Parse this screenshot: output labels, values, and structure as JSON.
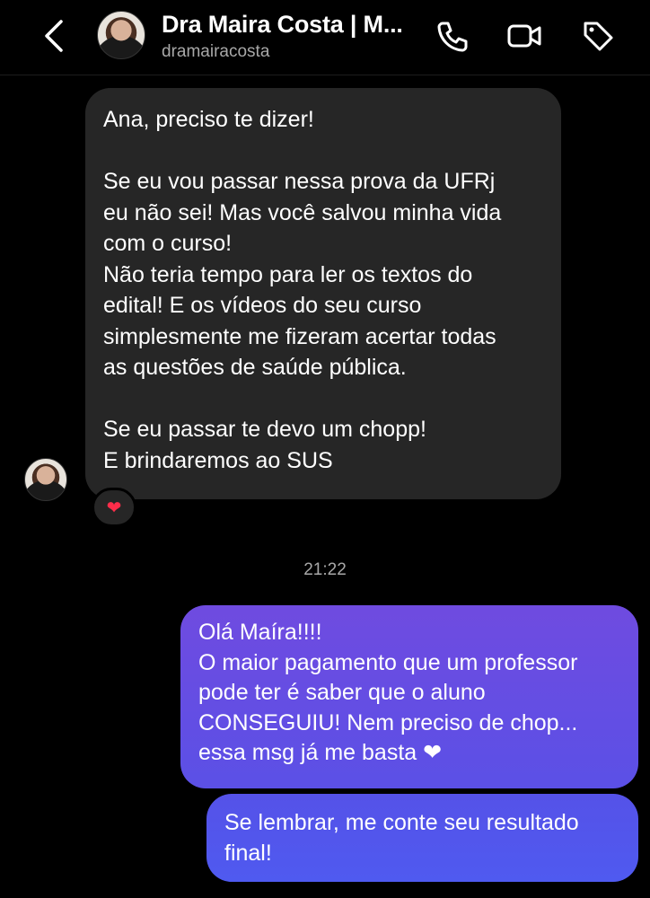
{
  "header": {
    "title": "Dra Maira Costa | M...",
    "username": "dramairacosta",
    "icons": [
      "back-arrow-icon",
      "phone-icon",
      "video-camera-icon",
      "tag-icon"
    ]
  },
  "incoming": {
    "paragraphs": [
      [
        "Ana, preciso te dizer!"
      ],
      [
        "Se eu vou passar nessa prova da UFRj",
        "eu não sei! Mas você salvou minha vida",
        "com o curso!",
        "Não teria tempo para ler os textos do",
        "edital! E os vídeos do seu curso",
        "simplesmente me fizeram acertar todas",
        "as questões de saúde pública."
      ],
      [
        "Se eu passar te devo um chopp!",
        "E brindaremos ao SUS"
      ]
    ],
    "reaction": "❤"
  },
  "timestamp": "21:22",
  "outgoing": [
    {
      "lines": [
        "Olá Maíra!!!!",
        "O maior pagamento que um professor",
        "pode ter é saber que o aluno",
        "CONSEGUIU! Nem preciso de chop...",
        "essa msg já me basta ❤"
      ]
    },
    {
      "lines": [
        "Se lembrar, me conte seu resultado",
        "final!"
      ]
    }
  ],
  "colors": {
    "background": "#000000",
    "incoming_bubble": "#262626",
    "outgoing_bubble": "#6250e6",
    "heart": "#ff2d4a"
  }
}
